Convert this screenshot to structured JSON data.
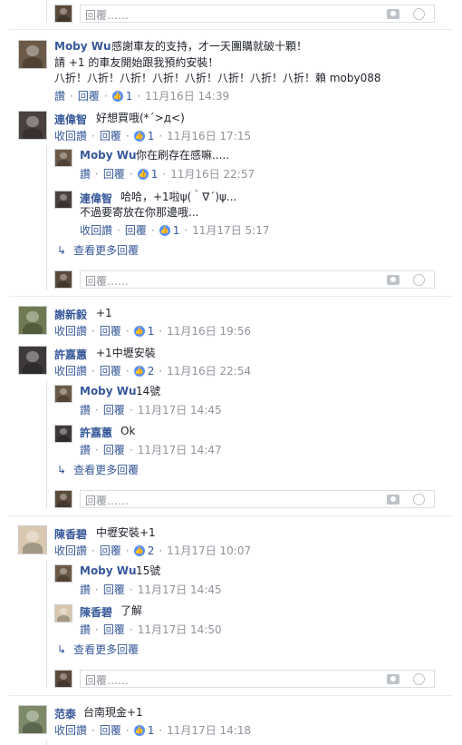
{
  "reply_placeholder": "回覆……",
  "labels": {
    "like": "讚",
    "unlike": "收回讚",
    "reply": "回覆",
    "more_replies": "查看更多回覆"
  },
  "comments": [
    {
      "author": "Moby Wu",
      "text_lines": [
        "感謝車友的支持，才一天團購就破十顆！",
        "請 +1 的車友開始跟我預約安裝！",
        "八折！八折！八折！八折！八折！八折！八折！八折！賴 moby088"
      ],
      "like_label": "讚",
      "likes": "1",
      "time": "11月16日 14:39"
    },
    {
      "author": "連偉智",
      "text": "好想買哦(*´>д<)",
      "like_label": "收回讚",
      "likes": "1",
      "time": "11月16日 17:15",
      "replies": [
        {
          "author": "Moby Wu",
          "text": "你在刷存在感嘛.....",
          "like_label": "讚",
          "likes": "1",
          "time": "11月16日 22:57"
        },
        {
          "author": "連偉智",
          "text_lines": [
            "哈哈，+1啦ψ(｀∇´)ψ...",
            "不過要寄放在你那邊哦..."
          ],
          "like_label": "收回讚",
          "likes": "1",
          "time": "11月17日 5:17"
        }
      ]
    },
    {
      "author": "謝新毅",
      "text": "+1",
      "like_label": "收回讚",
      "likes": "1",
      "time": "11月16日 19:56"
    },
    {
      "author": "許嘉蕙",
      "text": "+1中壢安裝",
      "like_label": "收回讚",
      "likes": "2",
      "time": "11月16日 22:54",
      "replies": [
        {
          "author": "Moby Wu",
          "text": "14號",
          "like_label": "讚",
          "time": "11月17日 14:45"
        },
        {
          "author": "許嘉蕙",
          "text": "Ok",
          "like_label": "讚",
          "time": "11月17日 14:47"
        }
      ]
    },
    {
      "author": "陳香碧",
      "text": "中壢安裝+1",
      "like_label": "收回讚",
      "likes": "2",
      "time": "11月17日 10:07",
      "replies": [
        {
          "author": "Moby Wu",
          "text": "15號",
          "like_label": "讚",
          "time": "11月17日 14:45"
        },
        {
          "author": "陳香碧",
          "text": "了解",
          "like_label": "讚",
          "time": "11月17日 14:50"
        }
      ]
    },
    {
      "author": "范泰",
      "text": "台南現金+1",
      "like_label": "收回讚",
      "likes": "1",
      "time": "11月17日 14:18"
    }
  ],
  "colors": {
    "link": "#365899",
    "meta": "#90949c",
    "like_badge": "#5890ff",
    "border": "#dddfe2"
  }
}
